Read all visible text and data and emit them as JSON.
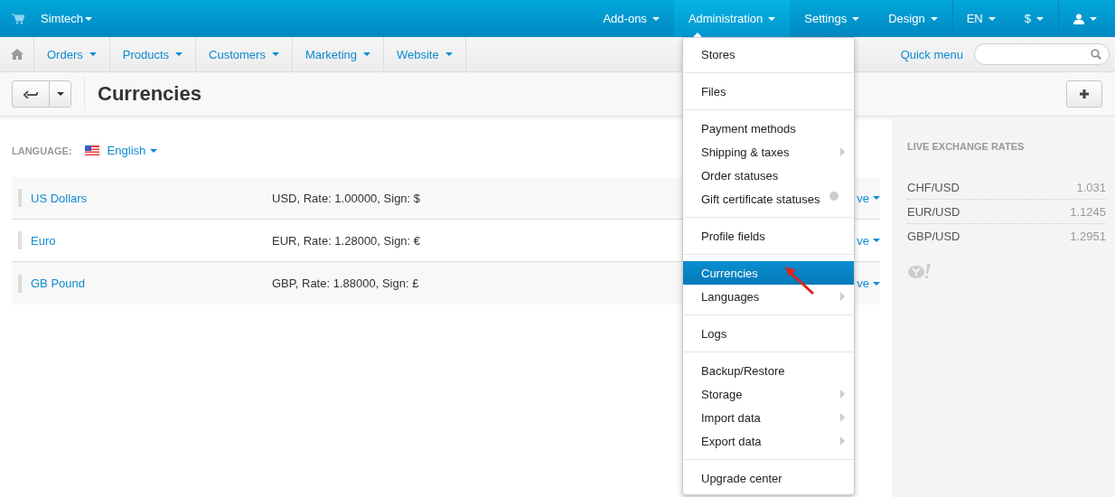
{
  "top_bar": {
    "store": "Simtech",
    "menu": [
      {
        "label": "Add-ons",
        "selected": false
      },
      {
        "label": "Administration",
        "selected": true
      },
      {
        "label": "Settings",
        "selected": false
      },
      {
        "label": "Design",
        "selected": false
      }
    ],
    "language": "EN",
    "currency": "$"
  },
  "main_nav": {
    "items": [
      "Orders",
      "Products",
      "Customers",
      "Marketing",
      "Website"
    ],
    "quick_menu": "Quick menu"
  },
  "page": {
    "title": "Currencies"
  },
  "language_selector": {
    "label": "LANGUAGE:",
    "value": "English"
  },
  "currencies": [
    {
      "name": "US Dollars",
      "details": "USD, Rate: 1.00000, Sign: $",
      "column_3": "ve"
    },
    {
      "name": "Euro",
      "details": "EUR, Rate: 1.28000, Sign: €",
      "column_3": "ve"
    },
    {
      "name": "GB Pound",
      "details": "GBP, Rate: 1.88000, Sign: £",
      "column_3": "ve"
    }
  ],
  "sidebar": {
    "title": "LIVE EXCHANGE RATES",
    "rates": [
      {
        "pair": "CHF/USD",
        "value": "1.031"
      },
      {
        "pair": "EUR/USD",
        "value": "1.1245"
      },
      {
        "pair": "GBP/USD",
        "value": "1.2951"
      }
    ]
  },
  "dropdown": {
    "groups": [
      [
        {
          "label": "Stores",
          "submenu": false,
          "addon": false,
          "selected": false
        }
      ],
      [
        {
          "label": "Files",
          "submenu": false,
          "addon": false,
          "selected": false
        }
      ],
      [
        {
          "label": "Payment methods",
          "submenu": false,
          "addon": false,
          "selected": false
        },
        {
          "label": "Shipping & taxes",
          "submenu": true,
          "addon": false,
          "selected": false
        },
        {
          "label": "Order statuses",
          "submenu": false,
          "addon": false,
          "selected": false
        },
        {
          "label": "Gift certificate statuses",
          "submenu": false,
          "addon": true,
          "selected": false
        }
      ],
      [
        {
          "label": "Profile fields",
          "submenu": false,
          "addon": false,
          "selected": false
        }
      ],
      [
        {
          "label": "Currencies",
          "submenu": false,
          "addon": false,
          "selected": true
        },
        {
          "label": "Languages",
          "submenu": true,
          "addon": false,
          "selected": false
        }
      ],
      [
        {
          "label": "Logs",
          "submenu": false,
          "addon": false,
          "selected": false
        }
      ],
      [
        {
          "label": "Backup/Restore",
          "submenu": false,
          "addon": false,
          "selected": false
        },
        {
          "label": "Storage",
          "submenu": true,
          "addon": false,
          "selected": false
        },
        {
          "label": "Import data",
          "submenu": true,
          "addon": false,
          "selected": false
        },
        {
          "label": "Export data",
          "submenu": true,
          "addon": false,
          "selected": false
        }
      ],
      [
        {
          "label": "Upgrade center",
          "submenu": false,
          "addon": false,
          "selected": false
        }
      ]
    ]
  }
}
